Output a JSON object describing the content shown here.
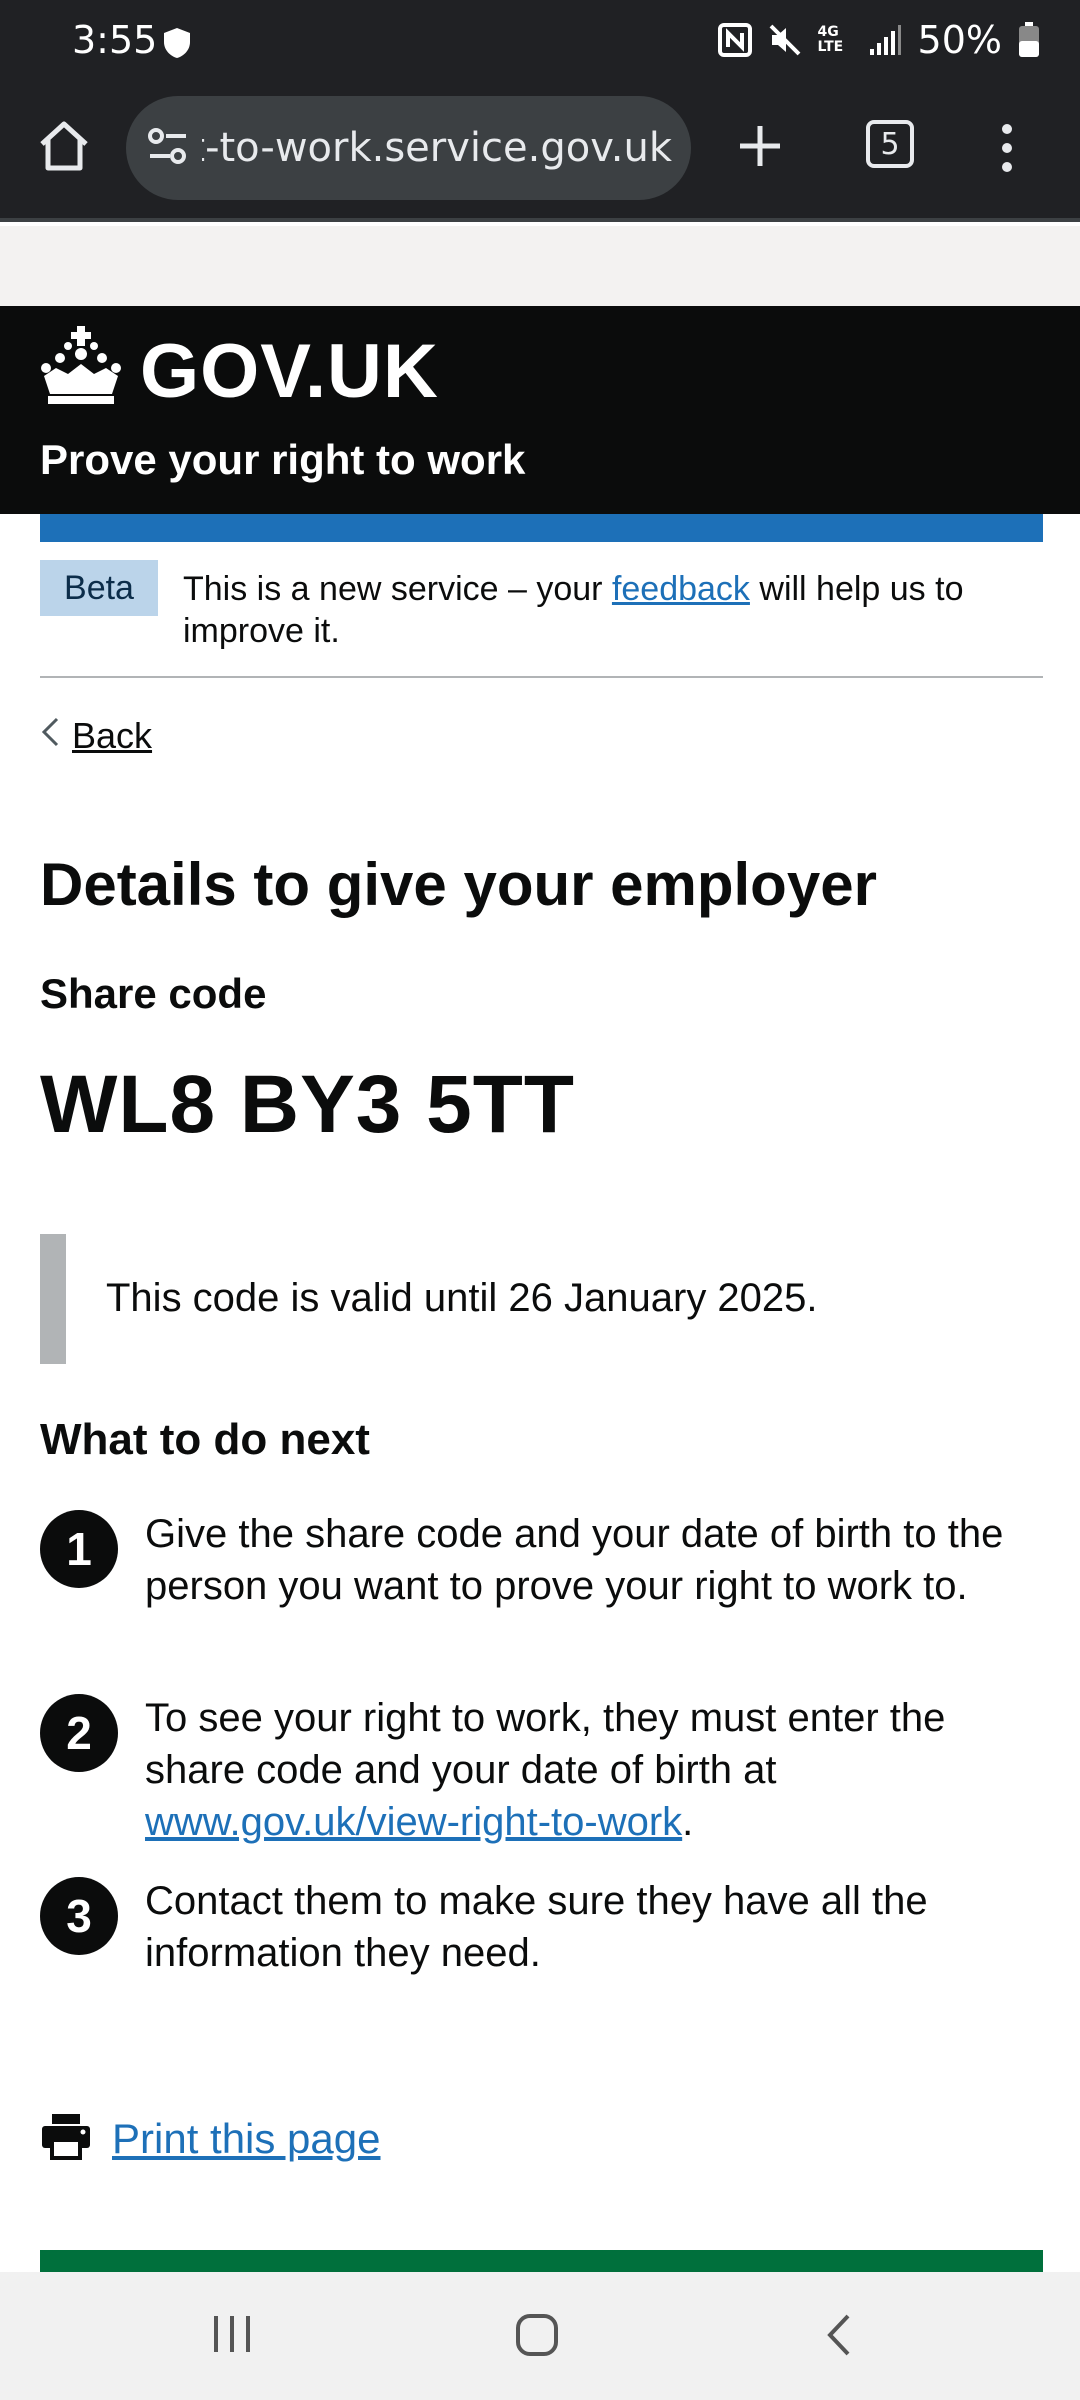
{
  "status_bar": {
    "time": "3:55",
    "battery": "50%",
    "network": "4G LTE"
  },
  "browser": {
    "url": "right-to-work.service.gov.uk",
    "tab_count": "5"
  },
  "header": {
    "logo_text": "GOV.UK",
    "service_name": "Prove your right to work"
  },
  "phase_banner": {
    "tag": "Beta",
    "text_before": "This is a new service – your ",
    "link_text": "feedback",
    "text_after": " will help us to improve it."
  },
  "back_link": "Back",
  "page": {
    "title": "Details to give your employer",
    "share_code_heading": "Share code",
    "share_code": "WL8 BY3 5TT",
    "validity": "This code is valid until 26 January 2025.",
    "next_heading": "What to do next",
    "steps": [
      {
        "number": "1",
        "text": "Give the share code and your date of birth to the person you want to prove your right to work to."
      },
      {
        "number": "2",
        "text": "To see your right to work, they must enter the share code and your date of birth at ",
        "link": "www.gov.uk/view-right-to-work",
        "suffix": "."
      },
      {
        "number": "3",
        "text": "Contact them to make sure they have all the information they need."
      }
    ],
    "print_link": "Print this page"
  },
  "colors": {
    "govuk_blue": "#1d70b8",
    "govuk_black": "#0b0c0c",
    "govuk_green": "#00703c",
    "beta_tag_bg": "#bbd4ea",
    "inset_border": "#b1b4b6"
  },
  "icons": [
    "shield-icon",
    "nfc-icon",
    "mute-icon",
    "signal-icon",
    "battery-icon",
    "home-icon",
    "tune-icon",
    "plus-icon",
    "tabs-icon",
    "menu-icon",
    "crown-icon",
    "chevron-left-icon",
    "printer-icon",
    "recents-icon",
    "nav-home-icon",
    "nav-back-icon"
  ]
}
